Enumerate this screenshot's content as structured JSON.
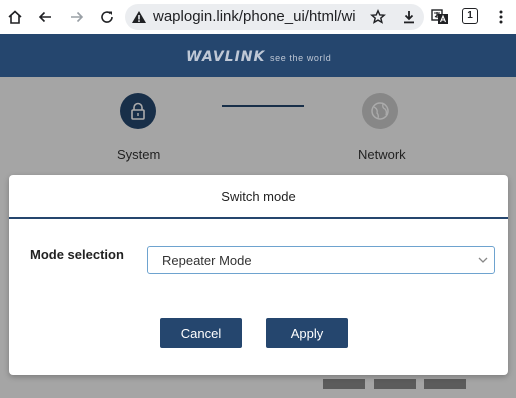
{
  "browser": {
    "url": "waplogin.link/phone_ui/html/wi",
    "tab_count": "1"
  },
  "header": {
    "logo": "WAVLINK",
    "tagline": "see the world"
  },
  "steps": [
    {
      "label": "System",
      "icon": "lock-icon",
      "state": "active"
    },
    {
      "label": "Network",
      "icon": "globe-icon",
      "state": "inactive"
    }
  ],
  "modal": {
    "title": "Switch mode",
    "mode_label": "Mode selection",
    "mode_value": "Repeater Mode",
    "cancel_label": "Cancel",
    "apply_label": "Apply"
  },
  "colors": {
    "brand": "#25466e",
    "select_border": "#6ea3cf"
  }
}
